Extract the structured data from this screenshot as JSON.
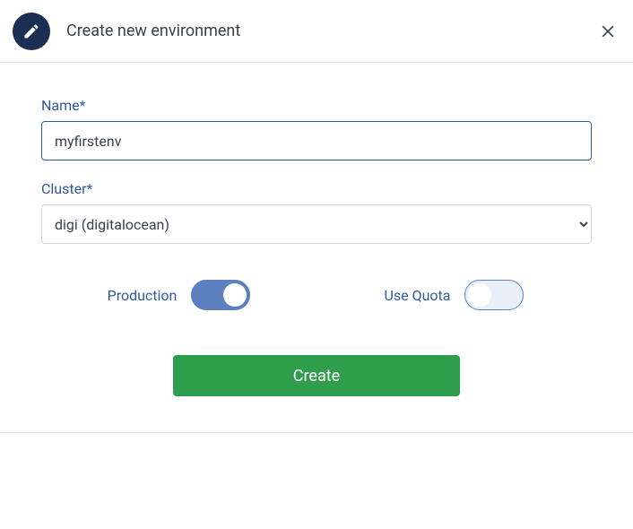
{
  "header": {
    "title": "Create new environment"
  },
  "form": {
    "name_label": "Name*",
    "name_value": "myfirstenv",
    "cluster_label": "Cluster*",
    "cluster_value": "digi (digitalocean)",
    "production_label": "Production",
    "use_quota_label": "Use Quota",
    "production_on": true,
    "use_quota_on": false
  },
  "actions": {
    "create_label": "Create"
  }
}
